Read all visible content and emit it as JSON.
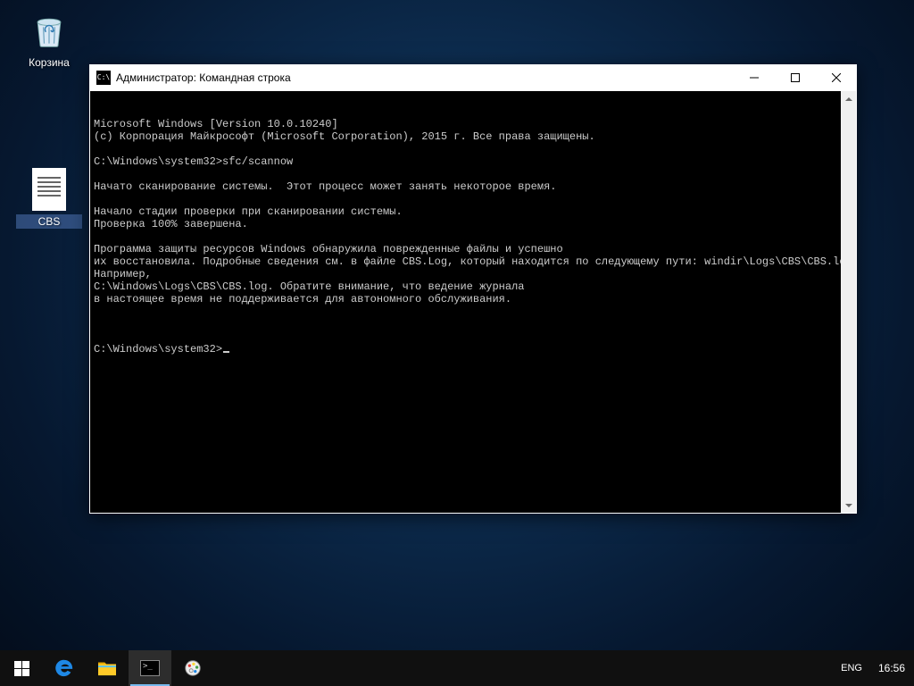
{
  "desktop": {
    "recycle_bin_label": "Корзина",
    "cbs_file_label": "CBS"
  },
  "cmd_window": {
    "title": "Администратор: Командная строка",
    "lines": [
      "Microsoft Windows [Version 10.0.10240]",
      "(c) Корпорация Майкрософт (Microsoft Corporation), 2015 г. Все права защищены.",
      "",
      "C:\\Windows\\system32>sfc/scannow",
      "",
      "Начато сканирование системы.  Этот процесс может занять некоторое время.",
      "",
      "Начало стадии проверки при сканировании системы.",
      "Проверка 100% завершена.",
      "",
      "Программа защиты ресурсов Windows обнаружила поврежденные файлы и успешно",
      "их восстановила. Подробные сведения см. в файле CBS.Log, который находится по следующему пути: windir\\Logs\\CBS\\CBS.log.",
      "Например,",
      "C:\\Windows\\Logs\\CBS\\CBS.log. Обратите внимание, что ведение журнала",
      "в настоящее время не поддерживается для автономного обслуживания.",
      ""
    ],
    "prompt": "C:\\Windows\\system32>"
  },
  "taskbar": {
    "lang": "ENG",
    "clock": "16:56"
  }
}
